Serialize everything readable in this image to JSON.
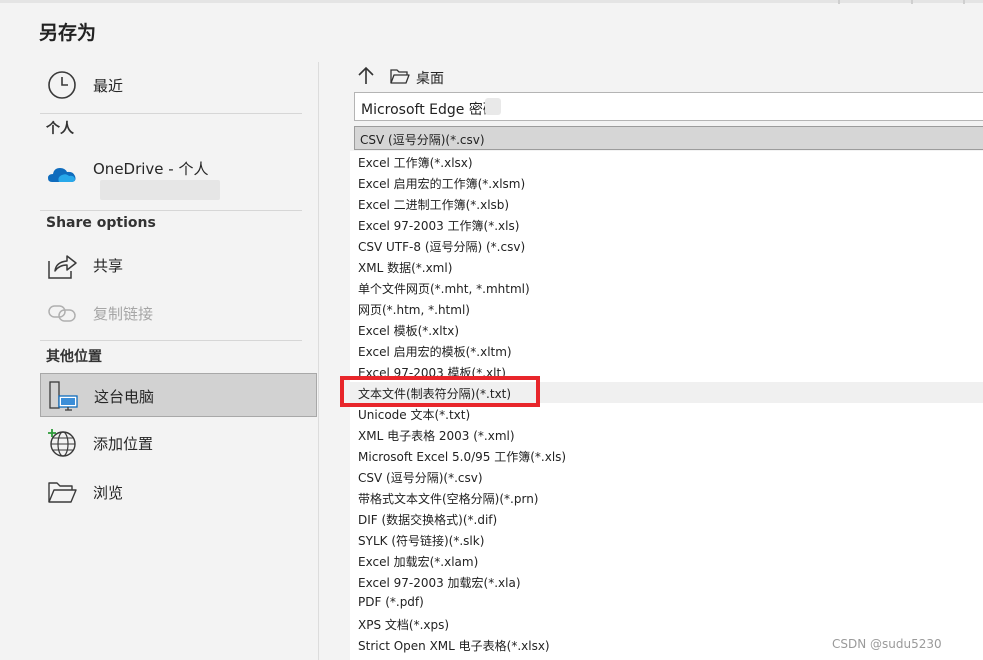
{
  "title": "另存为",
  "nav": {
    "recent": "最近",
    "section_personal": "个人",
    "onedrive": "OneDrive - 个人",
    "section_share": "Share options",
    "share": "共享",
    "copy_link": "复制链接",
    "section_other": "其他位置",
    "this_pc": "这台电脑",
    "add_place": "添加位置",
    "browse": "浏览"
  },
  "path": {
    "location": "桌面"
  },
  "filename": {
    "value": "Microsoft Edge 密码"
  },
  "file_type": {
    "selected": "CSV (逗号分隔)(*.csv)",
    "options": [
      "Excel 工作簿(*.xlsx)",
      "Excel 启用宏的工作簿(*.xlsm)",
      "Excel 二进制工作簿(*.xlsb)",
      "Excel 97-2003 工作簿(*.xls)",
      "CSV UTF-8 (逗号分隔) (*.csv)",
      "XML 数据(*.xml)",
      "单个文件网页(*.mht, *.mhtml)",
      "网页(*.htm, *.html)",
      "Excel 模板(*.xltx)",
      "Excel 启用宏的模板(*.xltm)",
      "Excel 97-2003 模板(*.xlt)",
      "文本文件(制表符分隔)(*.txt)",
      "Unicode 文本(*.txt)",
      "XML 电子表格 2003 (*.xml)",
      "Microsoft Excel 5.0/95 工作簿(*.xls)",
      "CSV (逗号分隔)(*.csv)",
      "带格式文本文件(空格分隔)(*.prn)",
      "DIF (数据交换格式)(*.dif)",
      "SYLK (符号链接)(*.slk)",
      "Excel 加载宏(*.xlam)",
      "Excel 97-2003 加载宏(*.xla)",
      "PDF (*.pdf)",
      "XPS 文档(*.xps)",
      "Strict Open XML 电子表格(*.xlsx)"
    ],
    "highlighted_option": "文本文件(制表符分隔)(*.txt)"
  },
  "watermark": "CSDN @sudu5230",
  "colors": {
    "highlight_box": "#e8262b",
    "selected_nav_bg": "#d2d2d2",
    "onedrive_blue": "#0f6cbd"
  }
}
